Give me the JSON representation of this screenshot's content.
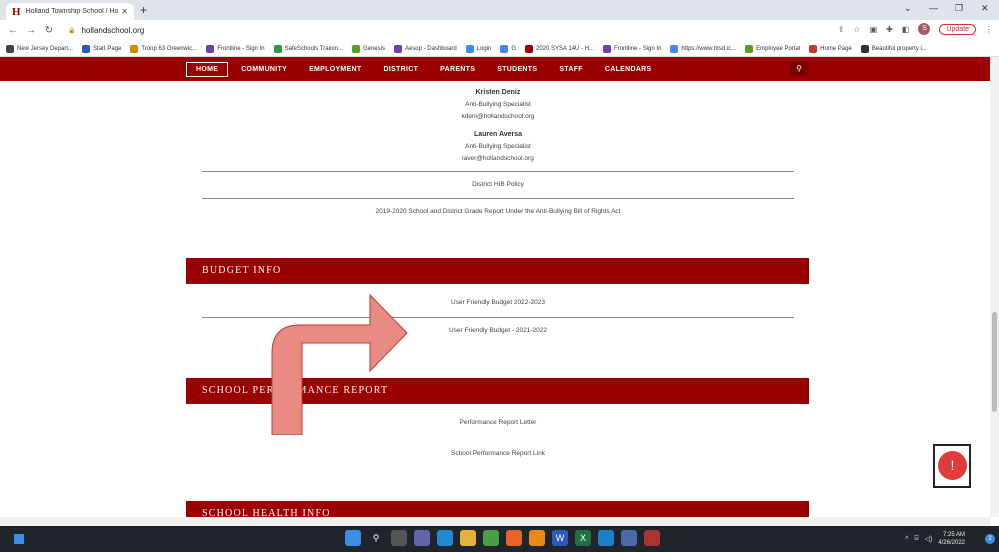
{
  "browser": {
    "tab_title": "Holland Township School / Home",
    "tab_favicon": "H",
    "url": "hollandschool.org",
    "update_label": "Update",
    "profile_initial": "S"
  },
  "bookmarks": [
    {
      "label": "New Jersey Depart...",
      "color": "#444"
    },
    {
      "label": "Start Page",
      "color": "#2b5bb8"
    },
    {
      "label": "Troop 63 Greenwic...",
      "color": "#d08a00"
    },
    {
      "label": "Frontline - Sign In",
      "color": "#6c3fb4"
    },
    {
      "label": "SafeSchools Trainin...",
      "color": "#2a9a4a"
    },
    {
      "label": "Genesis",
      "color": "#5a9e1e"
    },
    {
      "label": "Aesop - Dashboard",
      "color": "#6c3fb4"
    },
    {
      "label": "Login",
      "color": "#3a8ee6"
    },
    {
      "label": "G",
      "color": "#4285f4"
    },
    {
      "label": "2020 SYSA 14U - H...",
      "color": "#9b0000"
    },
    {
      "label": "Frontline - Sign In",
      "color": "#6c3fb4"
    },
    {
      "label": "https://www.htsd.ic...",
      "color": "#4285f4"
    },
    {
      "label": "Employee Portal",
      "color": "#5a9e1e"
    },
    {
      "label": "Home Page",
      "color": "#c0392b"
    },
    {
      "label": "Beautiful property i...",
      "color": "#333"
    }
  ],
  "nav": {
    "items": [
      "HOME",
      "COMMUNITY",
      "EMPLOYMENT",
      "DISTRICT",
      "PARENTS",
      "STUDENTS",
      "STAFF",
      "CALENDARS"
    ]
  },
  "contacts": [
    {
      "name": "Kristen Deniz",
      "role": "Anti-Bullying Specialist",
      "email": "kdeni@hollandschool.org"
    },
    {
      "name": "Lauren Aversa",
      "role": "Anti-Bullying Specialist",
      "email": "laver@hollandschool.org"
    }
  ],
  "hib": {
    "policy_link": "District HIB Policy",
    "grade_report_link": "2019-2020 School and District Grade Report Under the Anti-Bullying Bill of Rights Act"
  },
  "budget": {
    "heading": "BUDGET INFO",
    "links": [
      "User Friendly Budget 2022-2023",
      "User Friendly Budget - 2021-2022"
    ]
  },
  "performance": {
    "heading": "SCHOOL PERFORMANCE REPORT",
    "links": [
      "Performance Report Letter",
      "School Performance Report Link"
    ]
  },
  "health": {
    "heading": "SCHOOL HEALTH INFO"
  },
  "alert_symbol": "!",
  "taskbar": {
    "time": "7:25 AM",
    "date": "4/26/2022",
    "notification_count": "2"
  },
  "colors": {
    "brand": "#9b0000",
    "arrow_fill": "#e98b85",
    "alert": "#e23b3b"
  }
}
